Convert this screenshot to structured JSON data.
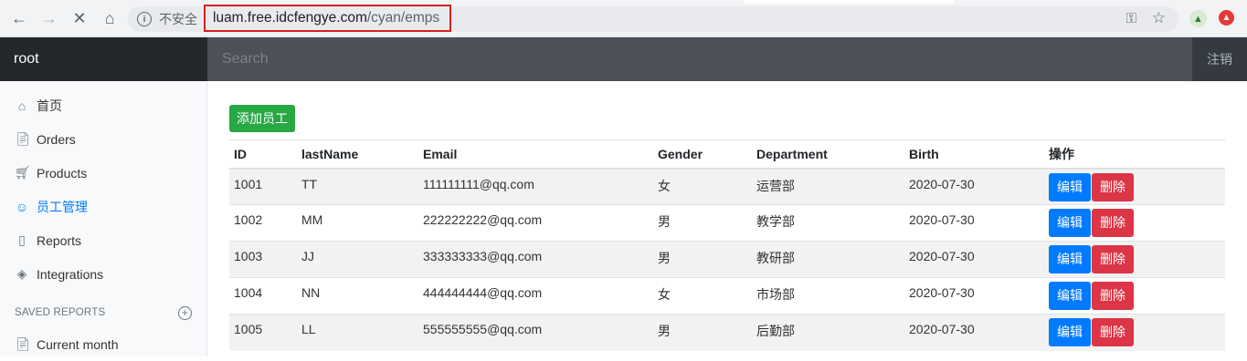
{
  "browser": {
    "insecure_label": "不安全",
    "url_host": "luam.free.idcfengye.com",
    "url_path": "/cyan/emps"
  },
  "navbar": {
    "brand": "root",
    "search_placeholder": "Search",
    "logout": "注销"
  },
  "sidebar": {
    "items": [
      {
        "label": "首页",
        "icon": "home-icon"
      },
      {
        "label": "Orders",
        "icon": "file-icon"
      },
      {
        "label": "Products",
        "icon": "cart-icon"
      },
      {
        "label": "员工管理",
        "icon": "users-icon"
      },
      {
        "label": "Reports",
        "icon": "bar-chart-icon"
      },
      {
        "label": "Integrations",
        "icon": "layers-icon"
      }
    ],
    "saved_heading": "SAVED REPORTS",
    "saved_items": [
      {
        "label": "Current month",
        "icon": "file-text-icon"
      }
    ]
  },
  "main": {
    "add_button": "添加员工",
    "table": {
      "headers": [
        "ID",
        "lastName",
        "Email",
        "Gender",
        "Department",
        "Birth",
        "操作"
      ],
      "rows": [
        [
          "1001",
          "TT",
          "111111111@qq.com",
          "女",
          "运营部",
          "2020-07-30"
        ],
        [
          "1002",
          "MM",
          "222222222@qq.com",
          "男",
          "教学部",
          "2020-07-30"
        ],
        [
          "1003",
          "JJ",
          "333333333@qq.com",
          "男",
          "教研部",
          "2020-07-30"
        ],
        [
          "1004",
          "NN",
          "444444444@qq.com",
          "女",
          "市场部",
          "2020-07-30"
        ],
        [
          "1005",
          "LL",
          "555555555@qq.com",
          "男",
          "后勤部",
          "2020-07-30"
        ]
      ],
      "edit_label": "编辑",
      "delete_label": "删除"
    }
  },
  "colors": {
    "navbar_bg": "#343a40",
    "active_link": "#007bff",
    "add_button": "#28a745",
    "edit_button": "#007bff",
    "delete_button": "#dc3545",
    "url_highlight_border": "#d81e1e"
  }
}
